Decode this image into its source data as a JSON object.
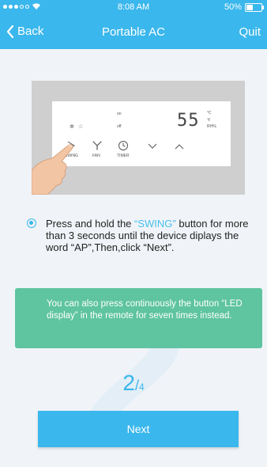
{
  "status_bar": {
    "time": "8:08 AM",
    "battery_percent": "50%",
    "battery_level": 0.5
  },
  "nav": {
    "back_label": "Back",
    "title": "Portable AC",
    "quit_label": "Quit"
  },
  "panel": {
    "display_digits": "55",
    "unit_c": "℃",
    "unit_f": "℉",
    "unit_rh": "RH%",
    "on_label": "on",
    "off_label": "off",
    "buttons": [
      {
        "label": "SWING",
        "icon": "swing-icon"
      },
      {
        "label": "FAN",
        "icon": "fan-icon"
      },
      {
        "label": "TIMER",
        "icon": "timer-icon"
      }
    ]
  },
  "instruction": {
    "part1": "Press and hold the ",
    "highlight": "“SWING”",
    "part2": " button for more than 3 seconds until the device diplays the word “AP”,Then,click “Next”."
  },
  "note": {
    "text": "You can also press continuously the button “LED display” in the remote for seven times instead."
  },
  "step": {
    "current": "2",
    "slash": "/",
    "total": "4"
  },
  "next_button": {
    "label": "Next"
  },
  "colors": {
    "primary": "#3ab7ec",
    "note_bg": "#5fc4a0"
  }
}
